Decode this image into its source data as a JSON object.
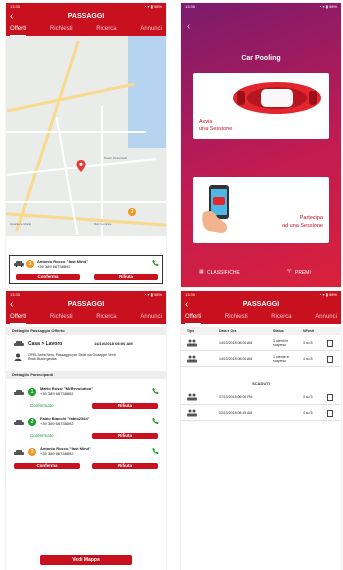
{
  "colors": {
    "brand_red": "#c8101e",
    "green": "#1b9e2c",
    "orange": "#f7931e"
  },
  "statusbar": {
    "time": "13:35",
    "right": "◔ ▾ ▮ 98%"
  },
  "screen1": {
    "title": "PASSAGGI",
    "tabs": [
      "Offerti",
      "Richiesti",
      "Ricerca",
      "Annunci"
    ],
    "map_labels": [
      "Teatro Petruzzelli",
      "Bari Centrale",
      "Quartiere Murat"
    ],
    "card": {
      "badge": "3",
      "name": "Antonio Rocco \"fast Mind\"",
      "phone": "+39 389 66738892",
      "confirm": "Conferma",
      "reject": "Rifiuta"
    }
  },
  "screen2": {
    "title": "Car Pooling",
    "panel1_text": [
      "Avvia",
      "una Sessione"
    ],
    "panel2_text": [
      "Partecipa",
      "ad una Sessione"
    ],
    "classifiche": "CLASSIFICHE",
    "premi": "PREMI"
  },
  "screen3": {
    "title": "PASSAGGI",
    "tabs": [
      "Offerti",
      "Richiesti",
      "Ricerca",
      "Annunci"
    ],
    "section1": "Dettaglio Passaggio Offerto",
    "route": "Casa > Lavoro",
    "datetime": "14/10/2018 08:00 AM",
    "info": "OPEL Astra Nero, Passaggio per Sede via Giuseppe Verdi",
    "info2": "Rock Music gestita",
    "section2": "Dettaglio Partecipanti",
    "participants": [
      {
        "badge": "1",
        "name": "Mario Rossi \"MrRevolution\"",
        "phone": "+39 389 66738892",
        "status": "Confermato",
        "reject": "Rifiuta"
      },
      {
        "badge": "2",
        "name": "Fabio Bianchi \"fabio2344\"",
        "phone": "+39 389 66738892",
        "status": "Confermato",
        "reject": "Rifiuta"
      },
      {
        "badge": "3",
        "name": "Antonio Rocco \"fast Mind\"",
        "phone": "+39 389 66738892",
        "confirm": "Conferma",
        "reject": "Rifiuta"
      }
    ],
    "maps_button": "Vedi Mappa"
  },
  "screen4": {
    "title": "PASSAGGI",
    "tabs": [
      "Offerti",
      "Richiesti",
      "Ricerca",
      "Annunci"
    ],
    "headers": [
      "Tipo",
      "Data e Ora",
      "Status",
      "NPosti"
    ],
    "rows": [
      {
        "date": "14/10/2018 08:00 AM",
        "status": "3 utenti in sospeso",
        "posti": "3 su 8"
      },
      {
        "date": "14/10/2018 08:00 AM",
        "status": "1 utente in sospeso",
        "posti": "4 su 8"
      }
    ],
    "scaduti_label": "SCADUTI",
    "expired": [
      {
        "date": "07/10/2018 06:00 PM",
        "posti": "3 su 5"
      },
      {
        "date": "02/10/2018 08:15 AM",
        "posti": "4 su 5"
      }
    ]
  }
}
